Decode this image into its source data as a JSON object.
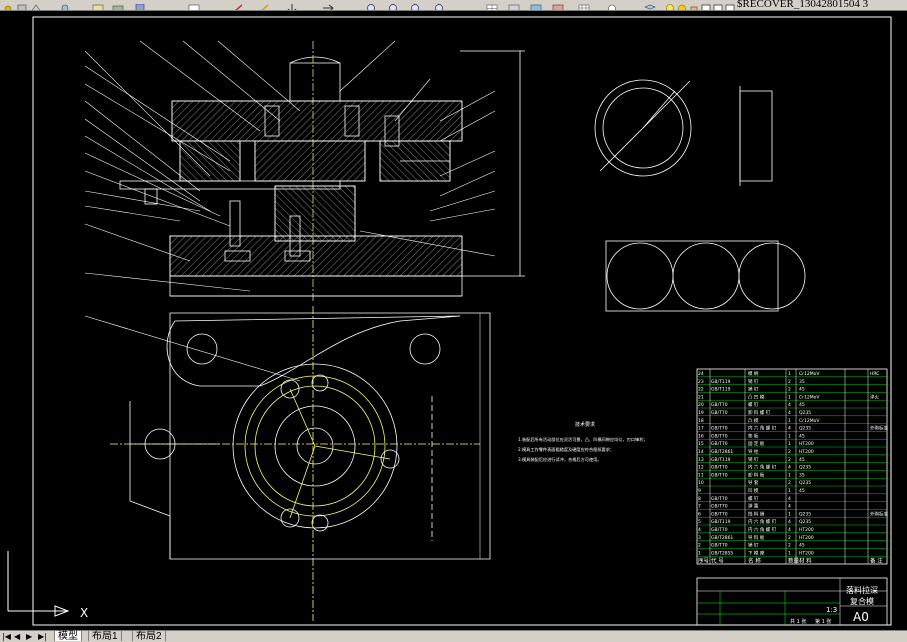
{
  "toolbar": {
    "file_title": "$RECOVER_13042801504 3",
    "icons": [
      "pan-icon",
      "zoom-realtime-icon",
      "zoom-window-icon",
      "zoom-previous-icon",
      "properties-icon",
      "design-center-icon",
      "tool-palettes-icon",
      "sheet-set-icon",
      "markup-icon",
      "quickcalc-icon",
      "layer-manager-icon",
      "layer-state-icon",
      "layer-freeze-icon",
      "layer-lock-icon",
      "layer-color-icon"
    ]
  },
  "drawing": {
    "technical_requirements_title": "技术要求",
    "technical_requirements_lines": [
      "1.装配后所有活动部位应灵活可靠，凸、凹模间隙应均匀，刃口锋利；",
      "2.模具工作零件表面粗糙度及硬度应符合图纸要求；",
      "3.模具装配后应进行试冲，合格后方可使用。"
    ],
    "ucs_label": "X",
    "bom_rows": [
      {
        "no": "24",
        "code": "",
        "name": "模 柄",
        "qty": "1",
        "material": "Cr12MoV",
        "note": "HRC"
      },
      {
        "no": "23",
        "code": "GB/T119",
        "name": "销 钉",
        "qty": "2",
        "material": "35",
        "note": ""
      },
      {
        "no": "22",
        "code": "GB/T119",
        "name": "销 钉",
        "qty": "2",
        "material": "45",
        "note": ""
      },
      {
        "no": "21",
        "code": "",
        "name": "凸 凹 模",
        "qty": "1",
        "material": "Cr12MoV",
        "note": "淬火"
      },
      {
        "no": "20",
        "code": "GB/T70",
        "name": "螺 钉",
        "qty": "4",
        "material": "45",
        "note": ""
      },
      {
        "no": "19",
        "code": "GB/T70",
        "name": "卸 料 螺 钉",
        "qty": "4",
        "material": "Q235",
        "note": ""
      },
      {
        "no": "18",
        "code": "",
        "name": "凸 模",
        "qty": "1",
        "material": "Cr12MoV",
        "note": ""
      },
      {
        "no": "17",
        "code": "GB/T70",
        "name": "内 六 角 螺 钉",
        "qty": "4",
        "material": "Q235",
        "note": "外购标准"
      },
      {
        "no": "16",
        "code": "GB/T70",
        "name": "垫 板",
        "qty": "1",
        "material": "45",
        "note": ""
      },
      {
        "no": "15",
        "code": "GB/T70",
        "name": "固 定 板",
        "qty": "1",
        "material": "HT200",
        "note": ""
      },
      {
        "no": "14",
        "code": "GB/T2861",
        "name": "导 柱",
        "qty": "2",
        "material": "HT200",
        "note": ""
      },
      {
        "no": "13",
        "code": "GB/T119",
        "name": "销 钉",
        "qty": "2",
        "material": "45",
        "note": ""
      },
      {
        "no": "12",
        "code": "GB/T70",
        "name": "内 六 角 螺 钉",
        "qty": "4",
        "material": "Q235",
        "note": ""
      },
      {
        "no": "11",
        "code": "GB/T70",
        "name": "卸 料 板",
        "qty": "1",
        "material": "35",
        "note": ""
      },
      {
        "no": "10",
        "code": "",
        "name": "导 套",
        "qty": "2",
        "material": "Q235",
        "note": ""
      },
      {
        "no": "9",
        "code": "",
        "name": "凹 模",
        "qty": "1",
        "material": "45",
        "note": ""
      },
      {
        "no": "8",
        "code": "GB/T70",
        "name": "螺 钉",
        "qty": "4",
        "material": "",
        "note": ""
      },
      {
        "no": "7",
        "code": "GB/T70",
        "name": "弹 簧",
        "qty": "4",
        "material": "",
        "note": ""
      },
      {
        "no": "6",
        "code": "GB/T70",
        "name": "挡 料 销",
        "qty": "1",
        "material": "Q235",
        "note": "外购标准"
      },
      {
        "no": "5",
        "code": "GB/T119",
        "name": "内 六 角 螺 钉",
        "qty": "4",
        "material": "Q235",
        "note": ""
      },
      {
        "no": "4",
        "code": "GB/T70",
        "name": "内 六 角 螺 钉",
        "qty": "4",
        "material": "HT200",
        "note": ""
      },
      {
        "no": "3",
        "code": "GB/T2861",
        "name": "导 料 板",
        "qty": "2",
        "material": "HT200",
        "note": ""
      },
      {
        "no": "2",
        "code": "GB/T70",
        "name": "销 钉",
        "qty": "2",
        "material": "45",
        "note": ""
      },
      {
        "no": "1",
        "code": "GB/T2855",
        "name": "下 模 座",
        "qty": "1",
        "material": "HT200",
        "note": ""
      }
    ],
    "bom_header": [
      "序号",
      "代 号",
      "名 称",
      "数量",
      "材 料",
      "备 注"
    ],
    "title_block": {
      "drawing_name_1": "落料拉深",
      "drawing_name_2": "复合模",
      "sheet_size": "A0",
      "scale": "1:3",
      "sheet_count": "共 1 张",
      "sheet_index": "第 1 张"
    }
  },
  "tabs": {
    "nav_arrows": [
      "|◀",
      "◀",
      "▶",
      "▶|"
    ],
    "items": [
      {
        "label": "模型",
        "active": true
      },
      {
        "label": "布局1",
        "active": false
      },
      {
        "label": "布局2",
        "active": false
      }
    ]
  }
}
